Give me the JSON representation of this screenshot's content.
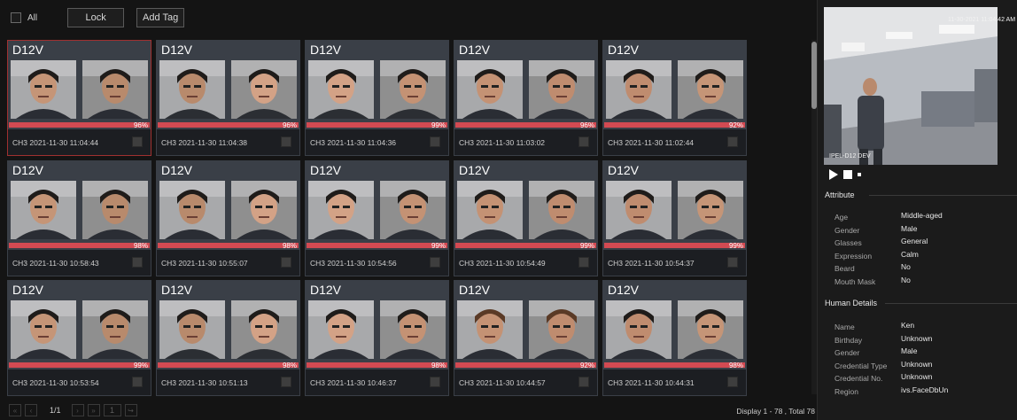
{
  "toolbar": {
    "all_label": "All",
    "lock_label": "Lock",
    "add_tag_label": "Add Tag"
  },
  "cards": [
    {
      "title": "D12V",
      "score": "96%",
      "timestamp": "CH3 2021-11-30 11:04:44"
    },
    {
      "title": "D12V",
      "score": "96%",
      "timestamp": "CH3 2021-11-30 11:04:38"
    },
    {
      "title": "D12V",
      "score": "99%",
      "timestamp": "CH3 2021-11-30 11:04:36"
    },
    {
      "title": "D12V",
      "score": "96%",
      "timestamp": "CH3 2021-11-30 11:03:02"
    },
    {
      "title": "D12V",
      "score": "92%",
      "timestamp": "CH3 2021-11-30 11:02:44"
    },
    {
      "title": "D12V",
      "score": "98%",
      "timestamp": "CH3 2021-11-30 10:58:43"
    },
    {
      "title": "D12V",
      "score": "98%",
      "timestamp": "CH3 2021-11-30 10:55:07"
    },
    {
      "title": "D12V",
      "score": "99%",
      "timestamp": "CH3 2021-11-30 10:54:56"
    },
    {
      "title": "D12V",
      "score": "99%",
      "timestamp": "CH3 2021-11-30 10:54:49"
    },
    {
      "title": "D12V",
      "score": "99%",
      "timestamp": "CH3 2021-11-30 10:54:37"
    },
    {
      "title": "D12V",
      "score": "99%",
      "timestamp": "CH3 2021-11-30 10:53:54"
    },
    {
      "title": "D12V",
      "score": "98%",
      "timestamp": "CH3 2021-11-30 10:51:13"
    },
    {
      "title": "D12V",
      "score": "98%",
      "timestamp": "CH3 2021-11-30 10:46:37"
    },
    {
      "title": "D12V",
      "score": "92%",
      "timestamp": "CH3 2021-11-30 10:44:57"
    },
    {
      "title": "D12V",
      "score": "98%",
      "timestamp": "CH3 2021-11-30 10:44:31"
    }
  ],
  "pager": {
    "page_info": "1/1",
    "page_input": "1",
    "display_text": "Display 1 - 78 , Total 78"
  },
  "video": {
    "timestamp": "11-30-2021 11:04:42 AM",
    "channel_label": "IPEL-D12 DEV"
  },
  "attribute": {
    "title": "Attribute",
    "rows": [
      {
        "key": "Age",
        "value": "Middle-aged"
      },
      {
        "key": "Gender",
        "value": "Male"
      },
      {
        "key": "Glasses",
        "value": "General"
      },
      {
        "key": "Expression",
        "value": "Calm"
      },
      {
        "key": "Beard",
        "value": "No"
      },
      {
        "key": "Mouth Mask",
        "value": "No"
      }
    ]
  },
  "human_details": {
    "title": "Human Details",
    "rows": [
      {
        "key": "Name",
        "value": "Ken"
      },
      {
        "key": "Birthday",
        "value": "Unknown"
      },
      {
        "key": "Gender",
        "value": "Male"
      },
      {
        "key": "Credential Type",
        "value": "Unknown"
      },
      {
        "key": "Credential No.",
        "value": "Unknown"
      },
      {
        "key": "Region",
        "value": "ivs.FaceDbUn"
      }
    ]
  },
  "colors": {
    "bar": "#d24a52",
    "card_bg": "#3a3f47",
    "selected_border": "#a03030"
  }
}
